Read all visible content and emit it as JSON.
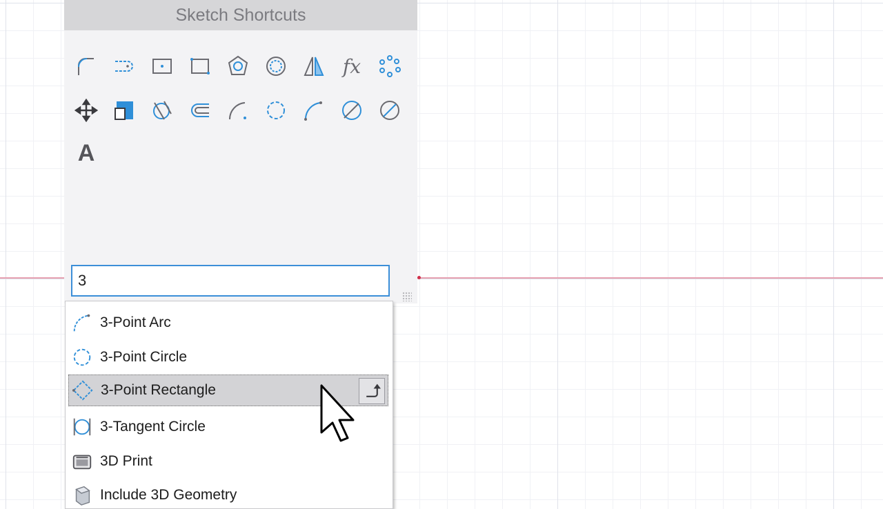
{
  "panel": {
    "title": "Sketch Shortcuts",
    "tools": [
      "fillet-icon",
      "slot-icon",
      "center-rectangle-icon",
      "two-point-rectangle-icon",
      "polygon-icon",
      "circle-icon",
      "mirror-icon",
      "fx-icon",
      "pattern-icon",
      "move-icon",
      "offset-box-icon",
      "tangent-arc-icon",
      "offset-icon",
      "arc-icon",
      "three-point-circle-icon",
      "three-point-arc-icon",
      "trim-circle-icon",
      "diameter-circle-icon",
      "text-icon"
    ],
    "fx_label": "fx",
    "text_tool_label": "A"
  },
  "search": {
    "value": "3"
  },
  "dropdown": {
    "items": [
      {
        "label": "3-Point Arc",
        "icon": "three-point-arc-icon"
      },
      {
        "label": "3-Point Circle",
        "icon": "three-point-circle-icon"
      },
      {
        "label": "3-Point Rectangle",
        "icon": "three-point-rectangle-icon",
        "selected": true
      },
      {
        "label": "3-Tangent Circle",
        "icon": "three-tangent-circle-icon"
      },
      {
        "label": "3D Print",
        "icon": "3d-print-icon"
      },
      {
        "label": "Include 3D Geometry",
        "icon": "include-3d-geometry-icon"
      }
    ]
  },
  "colors": {
    "accent": "#3b8ed8",
    "icon_blue": "#2f8fd8",
    "icon_gray": "#6a6a70",
    "axis": "#e6a0b0"
  }
}
